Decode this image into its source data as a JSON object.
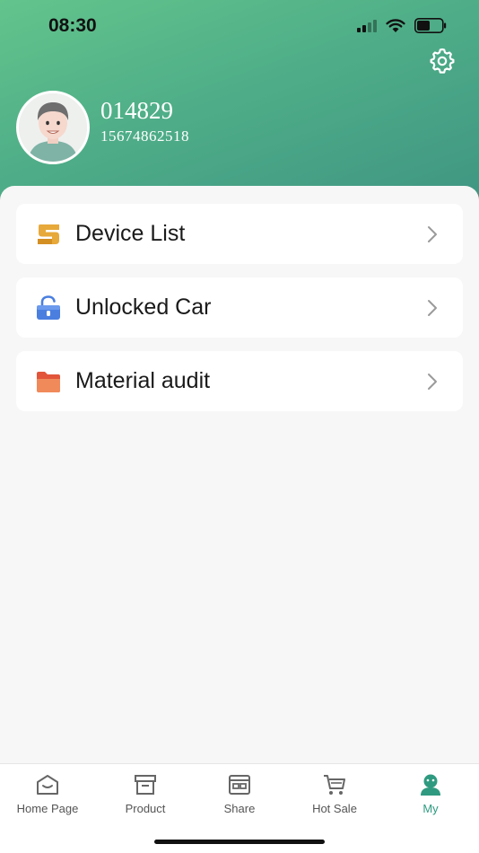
{
  "status_bar": {
    "time": "08:30",
    "icons": [
      "signal-icon",
      "wifi-icon",
      "battery-icon"
    ]
  },
  "header": {
    "settings_icon": "gear-icon",
    "user": {
      "name": "014829",
      "phone": "15674862518"
    }
  },
  "menu": [
    {
      "label": "Device List",
      "icon": "device-list-icon",
      "icon_color": "#e7a93a"
    },
    {
      "label": "Unlocked Car",
      "icon": "unlock-icon",
      "icon_color": "#4a7fe0"
    },
    {
      "label": "Material audit",
      "icon": "folder-icon",
      "icon_color": "#ee6b4a"
    }
  ],
  "tabbar": {
    "tabs": [
      {
        "label": "Home Page",
        "icon": "home-icon"
      },
      {
        "label": "Product",
        "icon": "product-icon"
      },
      {
        "label": "Share",
        "icon": "share-icon"
      },
      {
        "label": "Hot Sale",
        "icon": "cart-icon"
      },
      {
        "label": "My",
        "icon": "user-icon"
      }
    ],
    "active": "My"
  },
  "colors": {
    "header_gradient_start": "#63c48c",
    "header_gradient_end": "#3f9582",
    "active_tab": "#2f9a7f",
    "background": "#f7f7f7"
  }
}
